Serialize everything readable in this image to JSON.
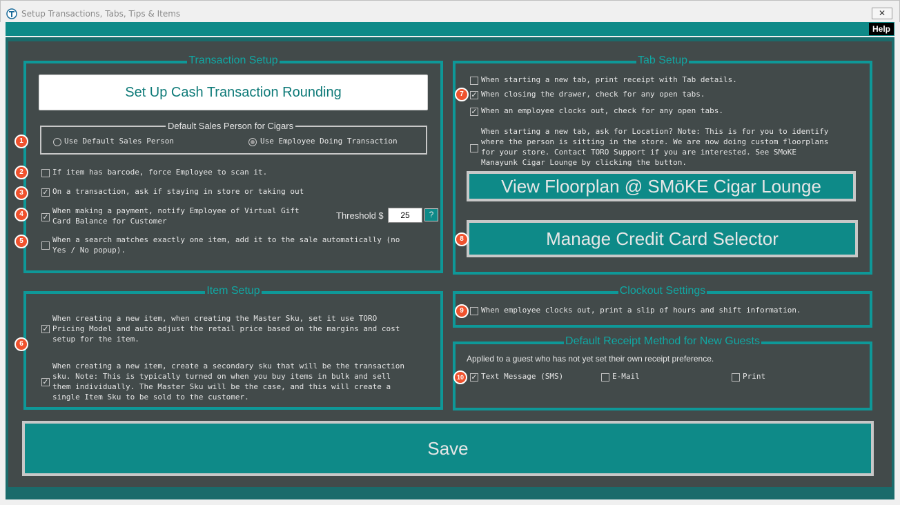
{
  "window": {
    "title": "Setup Transactions, Tabs, Tips & Items",
    "close_glyph": "✕",
    "help_label": "Help"
  },
  "transaction": {
    "title": "Transaction Setup",
    "rounding_button": "Set Up Cash Transaction Rounding",
    "sales_person_group": "Default Sales Person for Cigars",
    "radio_default": "Use Default Sales Person",
    "radio_employee": "Use Employee Doing Transaction",
    "barcode_label": "If item has barcode, force Employee to scan it.",
    "stay_label": "On a transaction, ask if staying in store or taking out",
    "giftcard_line1": "When making a payment, notify Employee of Virtual Gift",
    "giftcard_line2": "Card Balance for Customer",
    "threshold_label": "Threshold $",
    "threshold_value": "25",
    "help_q": "?",
    "search_line1": "When a search matches exactly one item, add it to the sale automatically (no",
    "search_line2": "Yes / No popup)."
  },
  "item": {
    "title": "Item Setup",
    "master_lines": [
      "When creating a new item, when creating the Master Sku, set it use TORO",
      "Pricing Model and auto adjust the retail price based on the margins and cost",
      "setup for the item."
    ],
    "secondary_lines": [
      "When creating a new item, create a secondary sku that will be the transaction",
      "sku. Note: This is typically turned on when you buy items in bulk and sell",
      "them individually. The Master Sku will be the case, and this will create a",
      "single Item Sku to be sold to the customer."
    ]
  },
  "tab": {
    "title": "Tab Setup",
    "print_receipt": "When starting a new tab, print receipt with Tab details.",
    "closing_drawer": "When closing the drawer, check for any open tabs.",
    "clock_out": "When an employee clocks out, check for any open tabs.",
    "location_lines": [
      "When starting a new tab, ask for Location? Note: This is for you to identify",
      "where the person is sitting in the store. We are now doing custom floorplans",
      "for your store. Contact TORO Support if you are interested. See SMoKE",
      "Manayunk Cigar Lounge by clicking the button."
    ],
    "floorplan_button": "View Floorplan @ SMōKE Cigar Lounge",
    "credit_button": "Manage Credit Card Selector"
  },
  "clockout": {
    "title": "Clockout Settings",
    "label": "When employee clocks out, print a slip of hours and shift information."
  },
  "receipt": {
    "title": "Default Receipt Method for New Guests",
    "description": "Applied to a guest who has not yet set their own receipt preference.",
    "sms": "Text Message (SMS)",
    "email": "E-Mail",
    "print": "Print"
  },
  "save_label": "Save",
  "checks": {
    "barcode": false,
    "stay": true,
    "giftcard": true,
    "search": false,
    "master": true,
    "secondary": true,
    "print_receipt": false,
    "closing_drawer": true,
    "clock_out": true,
    "location": false,
    "clockout_slip": false,
    "sms": true,
    "email": false,
    "print": false
  },
  "check_glyph": "✓",
  "badges": [
    "1",
    "2",
    "3",
    "4",
    "5",
    "6",
    "7",
    "8",
    "9",
    "10"
  ],
  "colors": {
    "accent": "#0e8a88",
    "title_teal": "#10a8a4",
    "panel": "#424a4a",
    "badge": "#f0522e"
  }
}
